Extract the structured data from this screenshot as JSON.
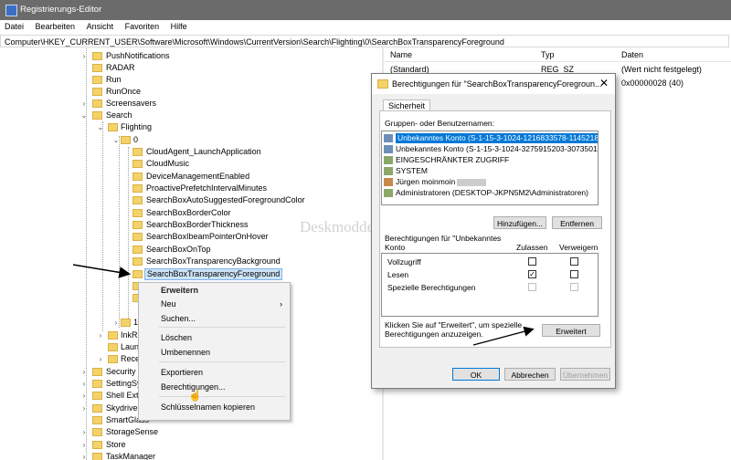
{
  "window": {
    "title": "Registrierungs-Editor"
  },
  "menu": [
    "Datei",
    "Bearbeiten",
    "Ansicht",
    "Favoriten",
    "Hilfe"
  ],
  "address": "Computer\\HKEY_CURRENT_USER\\Software\\Microsoft\\Windows\\CurrentVersion\\Search\\Flighting\\0\\SearchBoxTransparencyForeground",
  "tree": {
    "level1": [
      "PushNotifications",
      "RADAR",
      "Run",
      "RunOnce",
      "Screensavers",
      "Search"
    ],
    "flighting": "Flighting",
    "zero": "0",
    "keys": [
      "CloudAgent_LaunchApplication",
      "CloudMusic",
      "DeviceManagementEnabled",
      "ProactivePrefetchIntervalMinutes",
      "SearchBoxAutoSuggestedForegroundColor",
      "SearchBoxBorderColor",
      "SearchBoxBorderThickness",
      "SearchBoxIbeamPointerOnHover",
      "SearchBoxOnTop",
      "SearchBoxTransparencyBackground",
      "SearchBoxTransparencyForeground"
    ],
    "partial": [
      "1",
      "InkR",
      "Laun",
      "Rece"
    ],
    "lower": [
      "Security",
      "SettingSy",
      "Shell Ext",
      "Skydrive",
      "SmartGlass",
      "StorageSense",
      "Store",
      "TaskManager"
    ]
  },
  "list": {
    "headers": {
      "name": "Name",
      "type": "Typ",
      "data": "Daten"
    },
    "rows": [
      {
        "name": "(Standard)",
        "type": "REG_SZ",
        "data": "(Wert nicht festgelegt)"
      },
      {
        "name": "",
        "type": "",
        "data": "0x00000028 (40)"
      }
    ]
  },
  "context_menu": {
    "header": "Erweitern",
    "items": [
      "Neu",
      "Suchen...",
      "Löschen",
      "Umbenennen",
      "Exportieren",
      "Berechtigungen...",
      "Schlüsselnamen kopieren"
    ]
  },
  "dialog": {
    "title": "Berechtigungen für \"SearchBoxTransparencyForegroun...",
    "close": "✕",
    "tab": "Sicherheit",
    "groups_label": "Gruppen- oder Benutzernamen:",
    "users": [
      "Unbekanntes Konto (S-1-15-3-1024-1216833578-11452189...",
      "Unbekanntes Konto (S-1-15-3-1024-3275915203-30735013...",
      "EINGESCHRÄNKTER ZUGRIFF",
      "SYSTEM",
      "Jürgen moinmoin",
      "Administratoren (DESKTOP-JKPN5M2\\Administratoren)"
    ],
    "add_button": "Hinzufügen...",
    "remove_button": "Entfernen",
    "perm_label": "Berechtigungen für \"Unbekanntes Konto",
    "col_allow": "Zulassen",
    "col_deny": "Verweigern",
    "perms": [
      {
        "name": "Vollzugriff",
        "allow": false,
        "deny": false,
        "disabled": false
      },
      {
        "name": "Lesen",
        "allow": true,
        "deny": false,
        "disabled": false
      },
      {
        "name": "Spezielle Berechtigungen",
        "allow": false,
        "deny": false,
        "disabled": true
      }
    ],
    "allow_mark": "✓",
    "advanced_hint": "Klicken Sie auf \"Erweitert\", um spezielle Berechtigungen anzuzeigen.",
    "advanced_button": "Erweitert",
    "ok": "OK",
    "cancel": "Abbrechen",
    "apply": "Übernehmen"
  },
  "watermark": "Deskmodder.de"
}
